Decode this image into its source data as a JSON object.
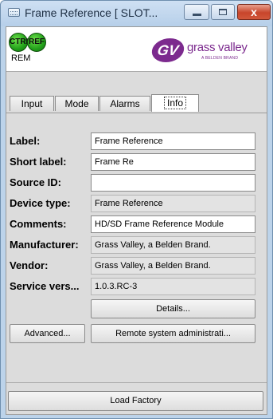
{
  "window": {
    "title": "Frame Reference [ SLOT...",
    "close_glyph": "x"
  },
  "header": {
    "leds": [
      {
        "label": "CTRL",
        "color": "#2fb81f"
      },
      {
        "label": "REF",
        "color": "#2fb81f"
      }
    ],
    "rem_label": "REM",
    "logo": {
      "mark": "GV",
      "name": "grass valley",
      "sub": "A BELDEN BRAND",
      "color": "#7c2a8e"
    }
  },
  "tabs": [
    {
      "label": "Input",
      "active": false
    },
    {
      "label": "Mode",
      "active": false
    },
    {
      "label": "Alarms",
      "active": false
    },
    {
      "label": "Info",
      "active": true
    }
  ],
  "info": {
    "fields": [
      {
        "label": "Label:",
        "value": "Frame Reference",
        "editable": true
      },
      {
        "label": "Short label:",
        "value": "Frame Re",
        "editable": true
      },
      {
        "label": "Source ID:",
        "value": "",
        "editable": true
      },
      {
        "label": "Device type:",
        "value": "Frame Reference",
        "editable": false
      },
      {
        "label": "Comments:",
        "value": "HD/SD Frame Reference Module",
        "editable": true
      },
      {
        "label": "Manufacturer:",
        "value": "Grass Valley, a Belden Brand.",
        "editable": false
      },
      {
        "label": "Vendor:",
        "value": "Grass Valley, a Belden Brand.",
        "editable": false
      },
      {
        "label": "Service vers...",
        "value": "1.0.3.RC-3",
        "editable": false
      }
    ],
    "details_button": "Details...",
    "advanced_button": "Advanced...",
    "remote_admin_button": "Remote system administrati..."
  },
  "footer": {
    "load_factory_button": "Load Factory"
  }
}
